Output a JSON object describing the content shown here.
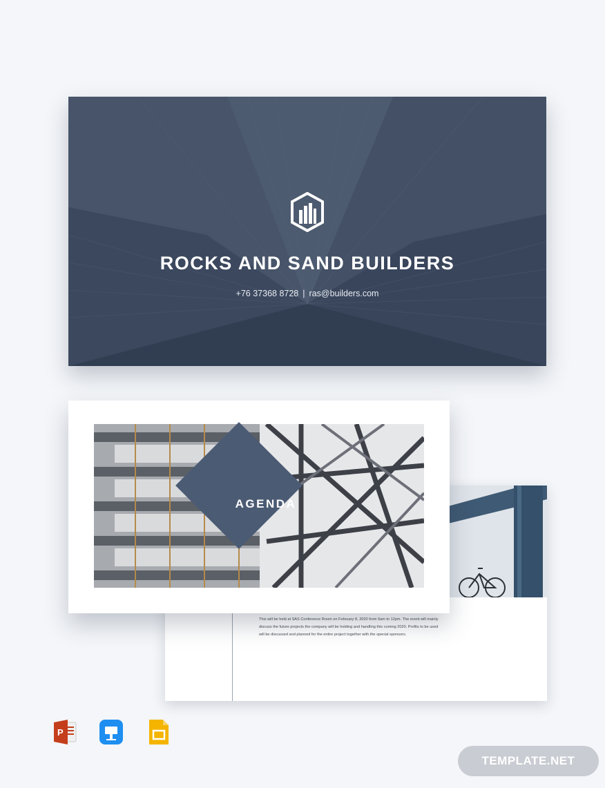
{
  "cover": {
    "company_name": "ROCKS AND SAND BUILDERS",
    "phone": "+76 37368 8728",
    "separator": "|",
    "email": "ras@builders.com"
  },
  "agenda_slide": {
    "label": "AGENDA"
  },
  "back_slide": {
    "body_text": "This will be held at SAS Conference Room on February 8, 2020 from 9am to 12pm. The event will mainly discuss the future projects the company will be holding and handling this coming 2020. Profits to be used will be discussed and planned for the entire project together with the special sponsors."
  },
  "app_icons": [
    "powerpoint-icon",
    "keynote-icon",
    "google-slides-icon"
  ],
  "brand": {
    "text": "TEMPLATE.NET"
  },
  "colors": {
    "background": "#f4f6f9",
    "cover_tint": "#344258",
    "diamond": "#4b5b74",
    "brand_pill": "#c9ccd2"
  }
}
